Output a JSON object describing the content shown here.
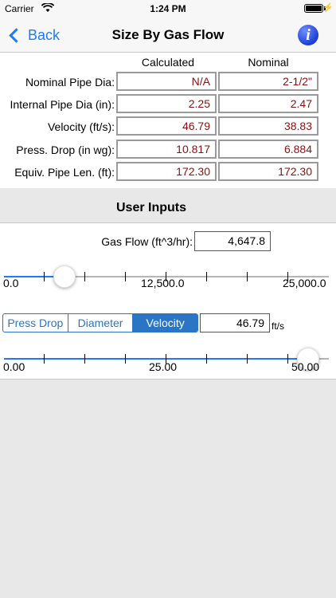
{
  "status_bar": {
    "carrier": "Carrier",
    "time": "1:24 PM"
  },
  "nav": {
    "back_label": "Back",
    "title": "Size By Gas Flow",
    "info_icon": "i"
  },
  "results": {
    "columns": [
      "Calculated",
      "Nominal"
    ],
    "rows": [
      {
        "label": "Nominal Pipe Dia:",
        "calculated": "N/A",
        "nominal": "2-1/2\""
      },
      {
        "label": "Internal Pipe Dia (in):",
        "calculated": "2.25",
        "nominal": "2.47"
      },
      {
        "label": "Velocity (ft/s):",
        "calculated": "46.79",
        "nominal": "38.83"
      },
      {
        "label": "Press. Drop (in wg):",
        "calculated": "10.817",
        "nominal": "6.884"
      },
      {
        "label": "Equiv. Pipe Len. (ft):",
        "calculated": "172.30",
        "nominal": "172.30"
      }
    ],
    "value_color": "#8b1010"
  },
  "user_inputs": {
    "header": "User Inputs",
    "gas_flow_label": "Gas Flow (ft^3/hr):",
    "gas_flow_value": "4,647.8",
    "gas_slider": {
      "min_label": "0.0",
      "mid_label": "12,500.0",
      "max_label": "25,000.0",
      "min": 0,
      "max": 25000,
      "value": 4647.8
    },
    "segments": [
      "Press Drop",
      "Diameter",
      "Velocity"
    ],
    "selected_segment": "Velocity",
    "velocity_value": "46.79",
    "velocity_unit": "ft/s",
    "velocity_slider": {
      "min_label": "0.00",
      "mid_label": "25.00",
      "max_label": "50.00",
      "min": 0,
      "max": 50,
      "value": 46.79
    }
  },
  "colors": {
    "accent": "#1e7cf2",
    "segment": "#2a76c4"
  }
}
